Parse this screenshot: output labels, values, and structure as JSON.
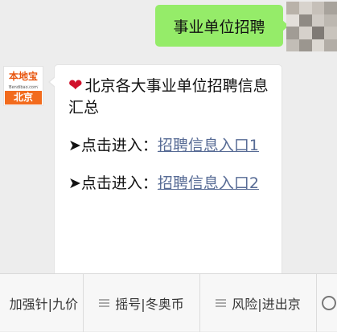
{
  "chat": {
    "outgoing": {
      "text": "事业单位招聘"
    },
    "incoming": {
      "sender_logo": "本地宝",
      "sender_domain": "Bendibao.com",
      "sender_city": "北京",
      "heart_icon": "❤",
      "headline": "北京各大事业单位招聘信息汇总",
      "entries": [
        {
          "prefix": "➤点击进入：",
          "link": "招聘信息入口1"
        },
        {
          "prefix": "➤点击进入：",
          "link": "招聘信息入口2"
        }
      ]
    }
  },
  "menu": {
    "items": [
      {
        "label": "加强针|九价"
      },
      {
        "label": "摇号|冬奥币"
      },
      {
        "label": "风险|进出京"
      }
    ]
  },
  "colors": {
    "outgoing_bubble": "#95ec69",
    "link": "#576b95",
    "brand": "#f26b1d"
  }
}
